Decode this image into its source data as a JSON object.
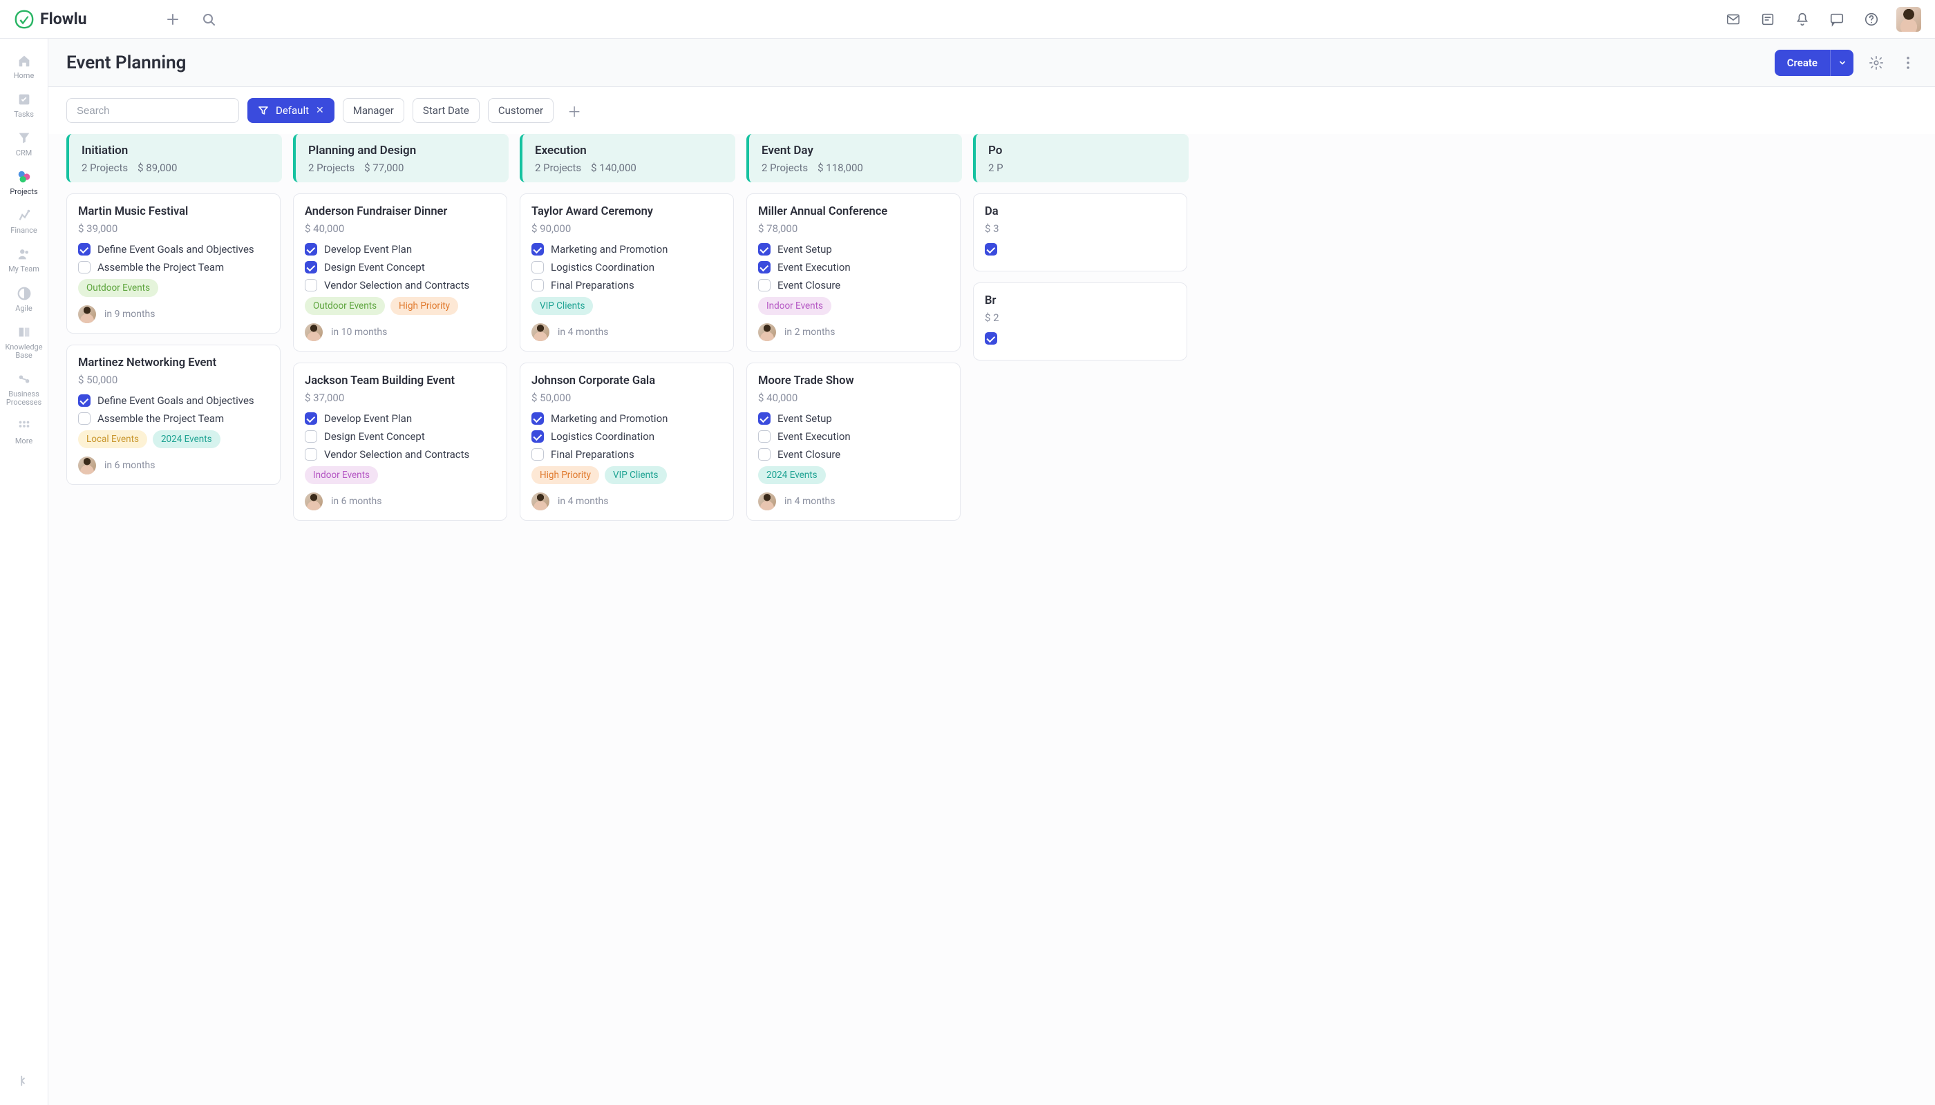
{
  "brand": "Flowlu",
  "sidebar": {
    "items": [
      {
        "label": "Home"
      },
      {
        "label": "Tasks"
      },
      {
        "label": "CRM"
      },
      {
        "label": "Projects"
      },
      {
        "label": "Finance"
      },
      {
        "label": "My Team"
      },
      {
        "label": "Agile"
      },
      {
        "label": "Knowledge Base"
      },
      {
        "label": "Business Processes"
      },
      {
        "label": "More"
      }
    ]
  },
  "page": {
    "title": "Event Planning",
    "create_label": "Create"
  },
  "filters": {
    "search_placeholder": "Search",
    "default_label": "Default",
    "chips": [
      "Manager",
      "Start Date",
      "Customer"
    ]
  },
  "tag_styles": {
    "Outdoor Events": {
      "bg": "#e5f4db",
      "fg": "#5ea53e"
    },
    "Indoor Events": {
      "bg": "#f4e3f5",
      "fg": "#b558c4"
    },
    "High Priority": {
      "bg": "#fde8d5",
      "fg": "#e07a2e"
    },
    "VIP Clients": {
      "bg": "#d6f3ee",
      "fg": "#1fa393"
    },
    "Local Events": {
      "bg": "#fdf2d5",
      "fg": "#c9972e"
    },
    "2024 Events": {
      "bg": "#d6f3ee",
      "fg": "#1fa393"
    }
  },
  "columns": [
    {
      "title": "Initiation",
      "meta_projects": "2 Projects",
      "meta_amount": "$ 89,000",
      "cards": [
        {
          "title": "Martin Music Festival",
          "amount": "$ 39,000",
          "tasks": [
            {
              "label": "Define Event Goals and Objectives",
              "done": true
            },
            {
              "label": "Assemble the Project Team",
              "done": false
            }
          ],
          "tags": [
            "Outdoor Events"
          ],
          "due": "in 9 months"
        },
        {
          "title": "Martinez Networking Event",
          "amount": "$ 50,000",
          "tasks": [
            {
              "label": "Define Event Goals and Objectives",
              "done": true
            },
            {
              "label": "Assemble the Project Team",
              "done": false
            }
          ],
          "tags": [
            "Local Events",
            "2024 Events"
          ],
          "due": "in 6 months"
        }
      ]
    },
    {
      "title": "Planning and Design",
      "meta_projects": "2 Projects",
      "meta_amount": "$ 77,000",
      "cards": [
        {
          "title": "Anderson Fundraiser Dinner",
          "amount": "$ 40,000",
          "tasks": [
            {
              "label": "Develop Event Plan",
              "done": true
            },
            {
              "label": "Design Event Concept",
              "done": true
            },
            {
              "label": "Vendor Selection and Contracts",
              "done": false
            }
          ],
          "tags": [
            "Outdoor Events",
            "High Priority"
          ],
          "due": "in 10 months"
        },
        {
          "title": "Jackson Team Building Event",
          "amount": "$ 37,000",
          "tasks": [
            {
              "label": "Develop Event Plan",
              "done": true
            },
            {
              "label": "Design Event Concept",
              "done": false
            },
            {
              "label": "Vendor Selection and Contracts",
              "done": false
            }
          ],
          "tags": [
            "Indoor Events"
          ],
          "due": "in 6 months"
        }
      ]
    },
    {
      "title": "Execution",
      "meta_projects": "2 Projects",
      "meta_amount": "$ 140,000",
      "cards": [
        {
          "title": "Taylor Award Ceremony",
          "amount": "$ 90,000",
          "tasks": [
            {
              "label": "Marketing and Promotion",
              "done": true
            },
            {
              "label": "Logistics Coordination",
              "done": false
            },
            {
              "label": "Final Preparations",
              "done": false
            }
          ],
          "tags": [
            "VIP Clients"
          ],
          "due": "in 4 months"
        },
        {
          "title": "Johnson Corporate Gala",
          "amount": "$ 50,000",
          "tasks": [
            {
              "label": "Marketing and Promotion",
              "done": true
            },
            {
              "label": "Logistics Coordination",
              "done": true
            },
            {
              "label": "Final Preparations",
              "done": false
            }
          ],
          "tags": [
            "High Priority",
            "VIP Clients"
          ],
          "due": "in 4 months"
        }
      ]
    },
    {
      "title": "Event Day",
      "meta_projects": "2 Projects",
      "meta_amount": "$ 118,000",
      "cards": [
        {
          "title": "Miller Annual Conference",
          "amount": "$ 78,000",
          "tasks": [
            {
              "label": "Event Setup",
              "done": true
            },
            {
              "label": "Event Execution",
              "done": true
            },
            {
              "label": "Event Closure",
              "done": false
            }
          ],
          "tags": [
            "Indoor Events"
          ],
          "due": "in 2 months"
        },
        {
          "title": "Moore Trade Show",
          "amount": "$ 40,000",
          "tasks": [
            {
              "label": "Event Setup",
              "done": true
            },
            {
              "label": "Event Execution",
              "done": false
            },
            {
              "label": "Event Closure",
              "done": false
            }
          ],
          "tags": [
            "2024 Events"
          ],
          "due": "in 4 months"
        }
      ]
    },
    {
      "title": "Po",
      "meta_projects": "2 P",
      "meta_amount": "",
      "cards": [
        {
          "title": "Da",
          "amount": "$ 3",
          "tasks": [
            {
              "label": "",
              "done": true
            }
          ],
          "tags": [],
          "due": ""
        },
        {
          "title": "Br",
          "amount": "$ 2",
          "tasks": [
            {
              "label": "",
              "done": true
            }
          ],
          "tags": [],
          "due": ""
        }
      ]
    }
  ]
}
